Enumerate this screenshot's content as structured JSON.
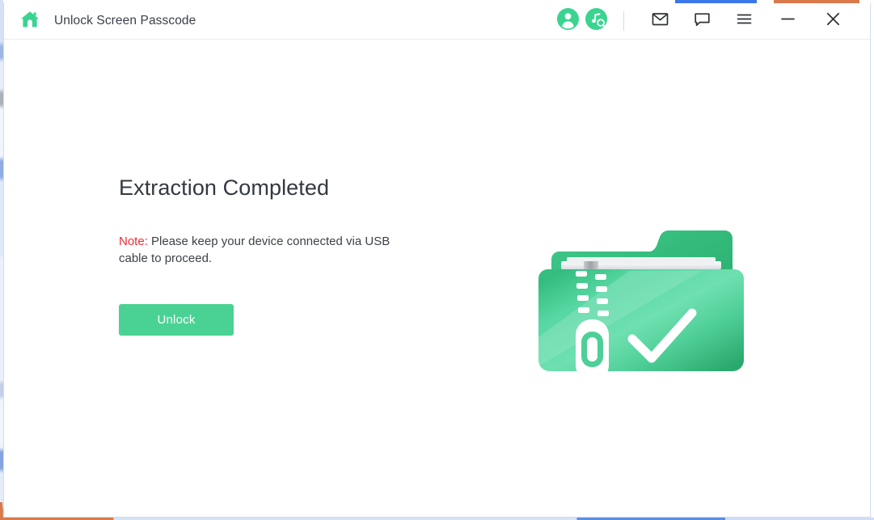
{
  "window": {
    "title": "Unlock Screen Passcode",
    "home_icon": "home-icon"
  },
  "titlebar": {
    "account_icon": "account-avatar-icon",
    "music_search_icon": "music-search-icon",
    "mail_icon": "mail-icon",
    "feedback_icon": "feedback-bubble-icon",
    "menu_icon": "hamburger-menu-icon",
    "minimize_icon": "minimize-icon",
    "close_icon": "close-icon"
  },
  "main": {
    "heading": "Extraction Completed",
    "note_label": "Note:",
    "note_text": " Please keep your device connected via USB cable to proceed.",
    "unlock_label": "Unlock",
    "illustration_name": "zip-folder-complete-illustration"
  },
  "colors": {
    "accent_green": "#4ad295",
    "note_red": "#ee2b32",
    "title_text": "#3b4149",
    "heading_text": "#333940",
    "folder_green_dark": "#2fae74",
    "folder_green_light": "#7fe3b8",
    "bg_bar_blue": "#3b78e7",
    "bg_bar_orange": "#d9794c"
  }
}
